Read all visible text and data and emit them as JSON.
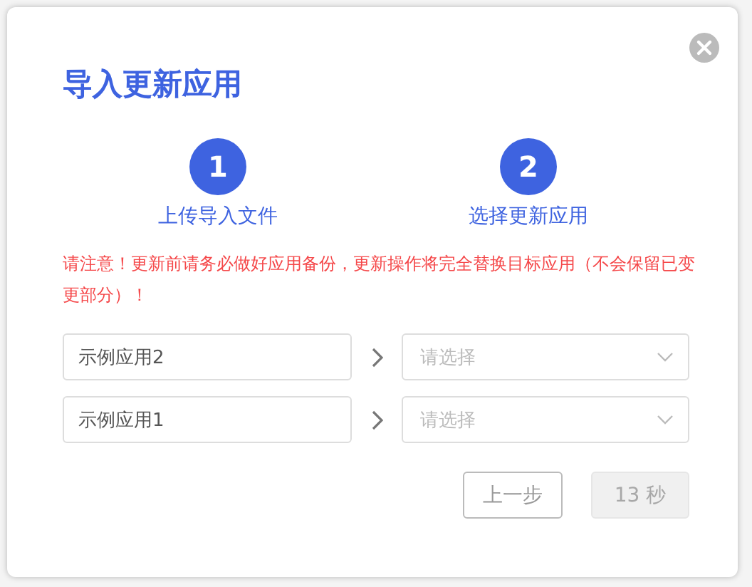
{
  "dialog": {
    "title": "导入更新应用"
  },
  "steps": [
    {
      "number": "1",
      "label": "上传导入文件",
      "active": true
    },
    {
      "number": "2",
      "label": "选择更新应用",
      "active": true
    }
  ],
  "warning": "请注意！更新前请务必做好应用备份，更新操作将完全替换目标应用（不会保留已变更部分）！",
  "mappings": [
    {
      "source": "示例应用2",
      "target": {
        "placeholder": "请选择"
      }
    },
    {
      "source": "示例应用1",
      "target": {
        "placeholder": "请选择"
      }
    }
  ],
  "buttons": [
    {
      "label": "上一步",
      "disabled": false
    },
    {
      "label": "13 秒",
      "disabled": true
    }
  ]
}
